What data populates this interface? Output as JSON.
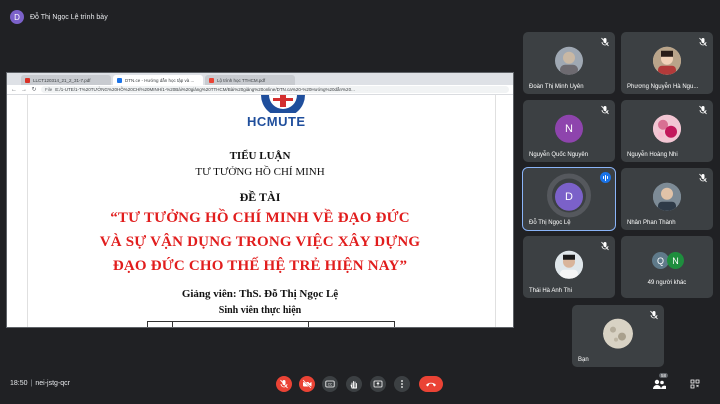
{
  "presenter": {
    "avatar_letter": "D",
    "label": "Đỗ Thị Ngọc Lệ trình bày"
  },
  "browser": {
    "tabs": [
      {
        "label": "LLCT120314_21_2_31-7.pdf",
        "active": false
      },
      {
        "label": "DTN.ce - Hướng dẫn học tập và ...",
        "active": true
      },
      {
        "label": "Lộ trình học TTHCM.pdf",
        "active": false
      }
    ],
    "url_label": "File",
    "url": "E:/1-UTE/1-T%20TƯỞNG%20HỒ%20CHÍ%20MINH/1-%20Bài%20giảng%20TTHCM/Bài%20giảng%20online/DTN.ca%20-%20Hướng%20dẫn%20..."
  },
  "document": {
    "logo_text": "HCMUTE",
    "line1": "TIỂU LUẬN",
    "line2": "TƯ TƯỞNG HỒ CHÍ MINH",
    "line3": "ĐỀ TÀI",
    "title_lines": [
      "“TƯ TƯỞNG HỒ CHÍ MINH VỀ ĐẠO ĐỨC",
      "VÀ SỰ VẬN DỤNG TRONG VIỆC XÂY DỰNG",
      "ĐẠO ĐỨC CHO THẾ HỆ TRẺ HIỆN NAY”"
    ],
    "lecturer": "Giảng viên: ThS. Đỗ Thị Ngọc Lệ",
    "students": "Sinh viên thực hiện"
  },
  "participants": {
    "p1": {
      "name": "Đoàn Thị Minh Uyên"
    },
    "p2": {
      "name": "Phương Nguyễn Hà Ngu..."
    },
    "p3": {
      "name": "Nguyễn Quốc Nguyên",
      "letter": "N"
    },
    "p4": {
      "name": "Nguyễn Hoàng Nhi"
    },
    "p5": {
      "name": "Đỗ Thị Ngọc Lệ",
      "letter": "D"
    },
    "p6": {
      "name": "Nhân Phan Thành"
    },
    "p7": {
      "name": "Thái Hà Anh Thi"
    },
    "others": {
      "label": "49 người khác",
      "letters": [
        "Q",
        "N"
      ]
    },
    "self": {
      "name": "Bạn"
    }
  },
  "meeting": {
    "time": "18:50",
    "code": "nei-jstg-qcr",
    "people_badge": "58"
  },
  "colors": {
    "accent": "#8ab4f8",
    "end_call": "#ea4335",
    "title_red": "#e11d1d"
  }
}
